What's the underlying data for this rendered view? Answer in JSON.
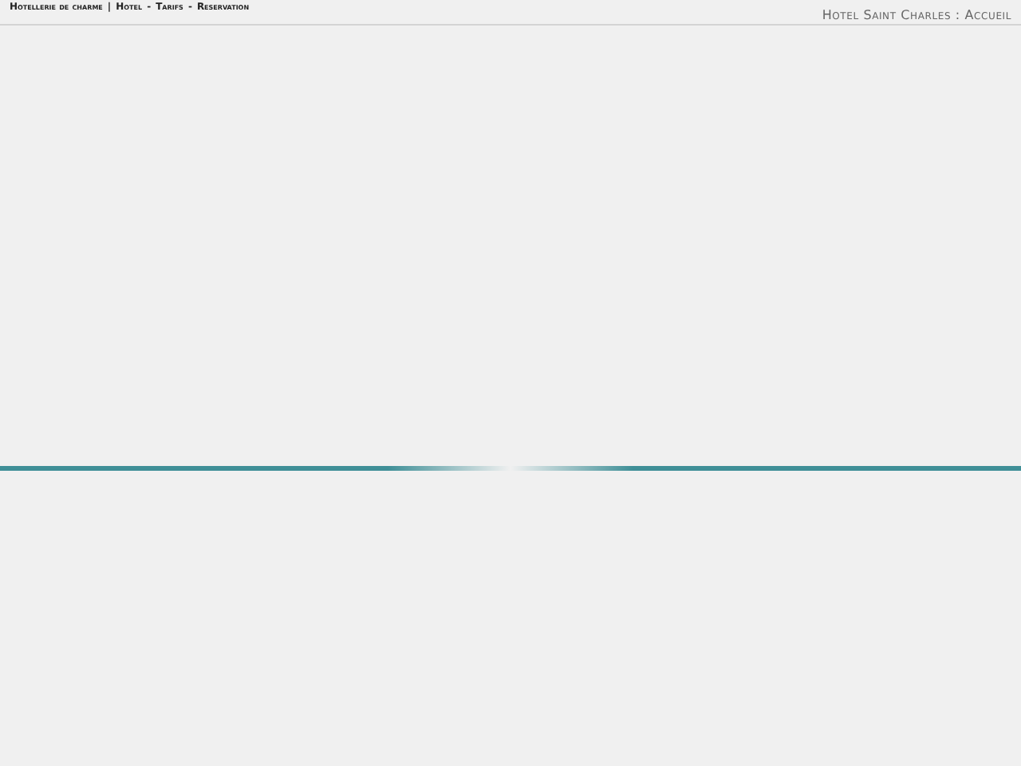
{
  "nav": {
    "tagline": "Hotellerie de charme",
    "separator": "|",
    "links": [
      {
        "label": "Hotel"
      },
      {
        "label": "Tarifs"
      },
      {
        "label": "Reservation"
      }
    ],
    "link_separator": "-"
  },
  "page_title": "Hotel Saint Charles : Accueil"
}
